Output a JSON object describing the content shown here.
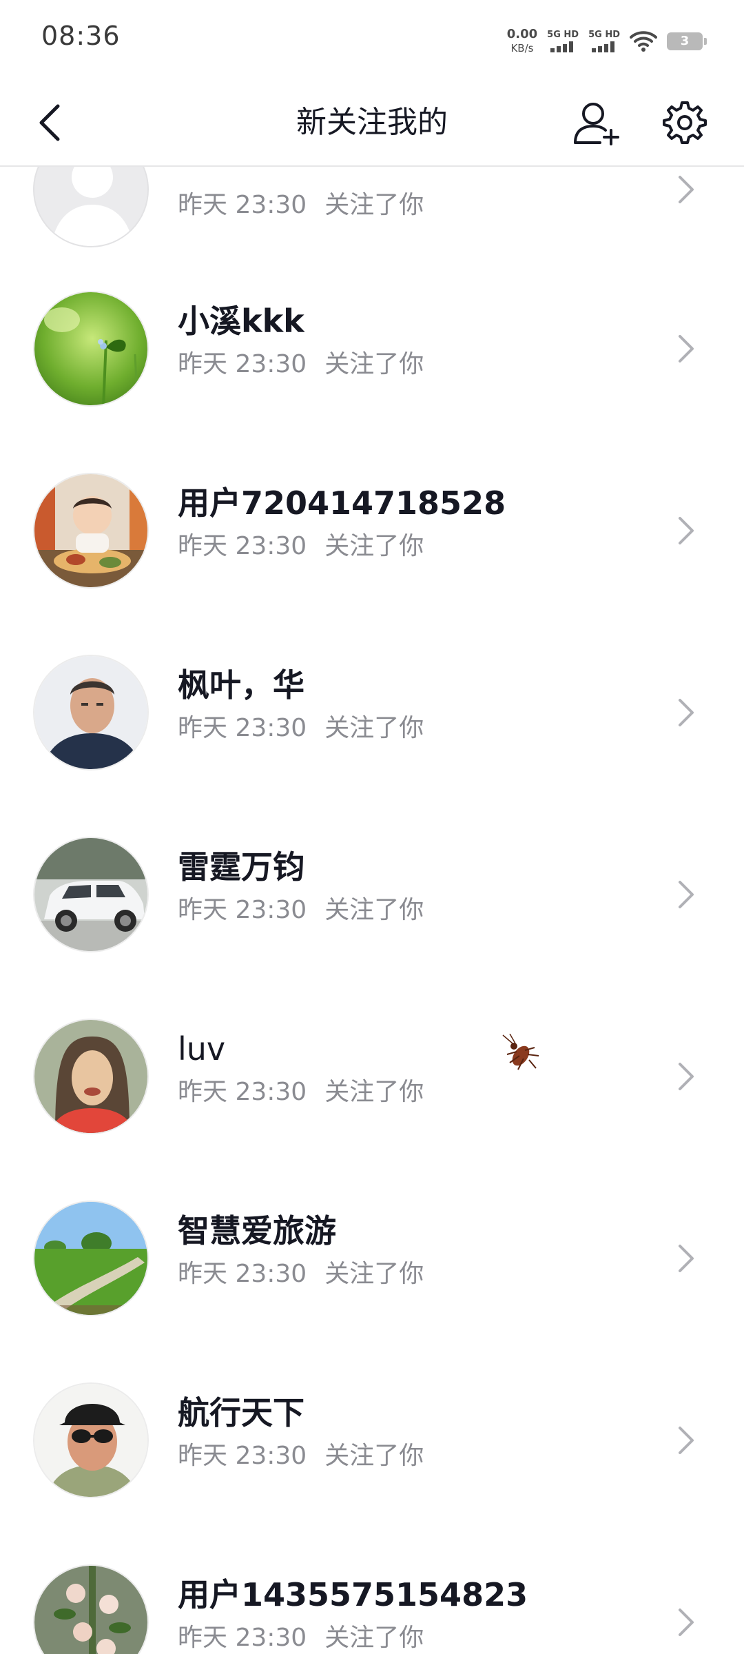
{
  "status_bar": {
    "time": "08:36",
    "net_speed_value": "0.00",
    "net_speed_unit": "KB/s",
    "sim1": "5G HD",
    "sim2": "5G HD",
    "battery": "3"
  },
  "nav": {
    "title": "新关注我的",
    "back_icon": "chevron-left-icon",
    "add_user_icon": "add-user-icon",
    "settings_icon": "gear-icon"
  },
  "followers": [
    {
      "name": "",
      "time": "昨天 23:30",
      "action": "关注了你",
      "avatar": "default-avatar"
    },
    {
      "name": "小溪kkk",
      "time": "昨天 23:30",
      "action": "关注了你",
      "avatar": "green-plant-photo"
    },
    {
      "name": "用户720414718528",
      "time": "昨天 23:30",
      "action": "关注了你",
      "avatar": "child-photo"
    },
    {
      "name": "枫叶，华",
      "time": "昨天 23:30",
      "action": "关注了你",
      "avatar": "man-portrait"
    },
    {
      "name": "雷霆万钧",
      "time": "昨天 23:30",
      "action": "关注了你",
      "avatar": "white-suv-photo"
    },
    {
      "name": "luv",
      "time": "昨天 23:30",
      "action": "关注了你",
      "avatar": "woman-portrait"
    },
    {
      "name": "智慧爱旅游",
      "time": "昨天 23:30",
      "action": "关注了你",
      "avatar": "meadow-path-photo"
    },
    {
      "name": "航行天下",
      "time": "昨天 23:30",
      "action": "关注了你",
      "avatar": "man-sunglasses-portrait"
    },
    {
      "name": "用户1435575154823",
      "time": "昨天 23:30",
      "action": "关注了你",
      "avatar": "flower-vine-photo"
    }
  ],
  "colors": {
    "name_text": "#161823",
    "meta_text": "#8a8b91",
    "divider": "#e6e6e8",
    "chevron": "#b0b1b6"
  }
}
